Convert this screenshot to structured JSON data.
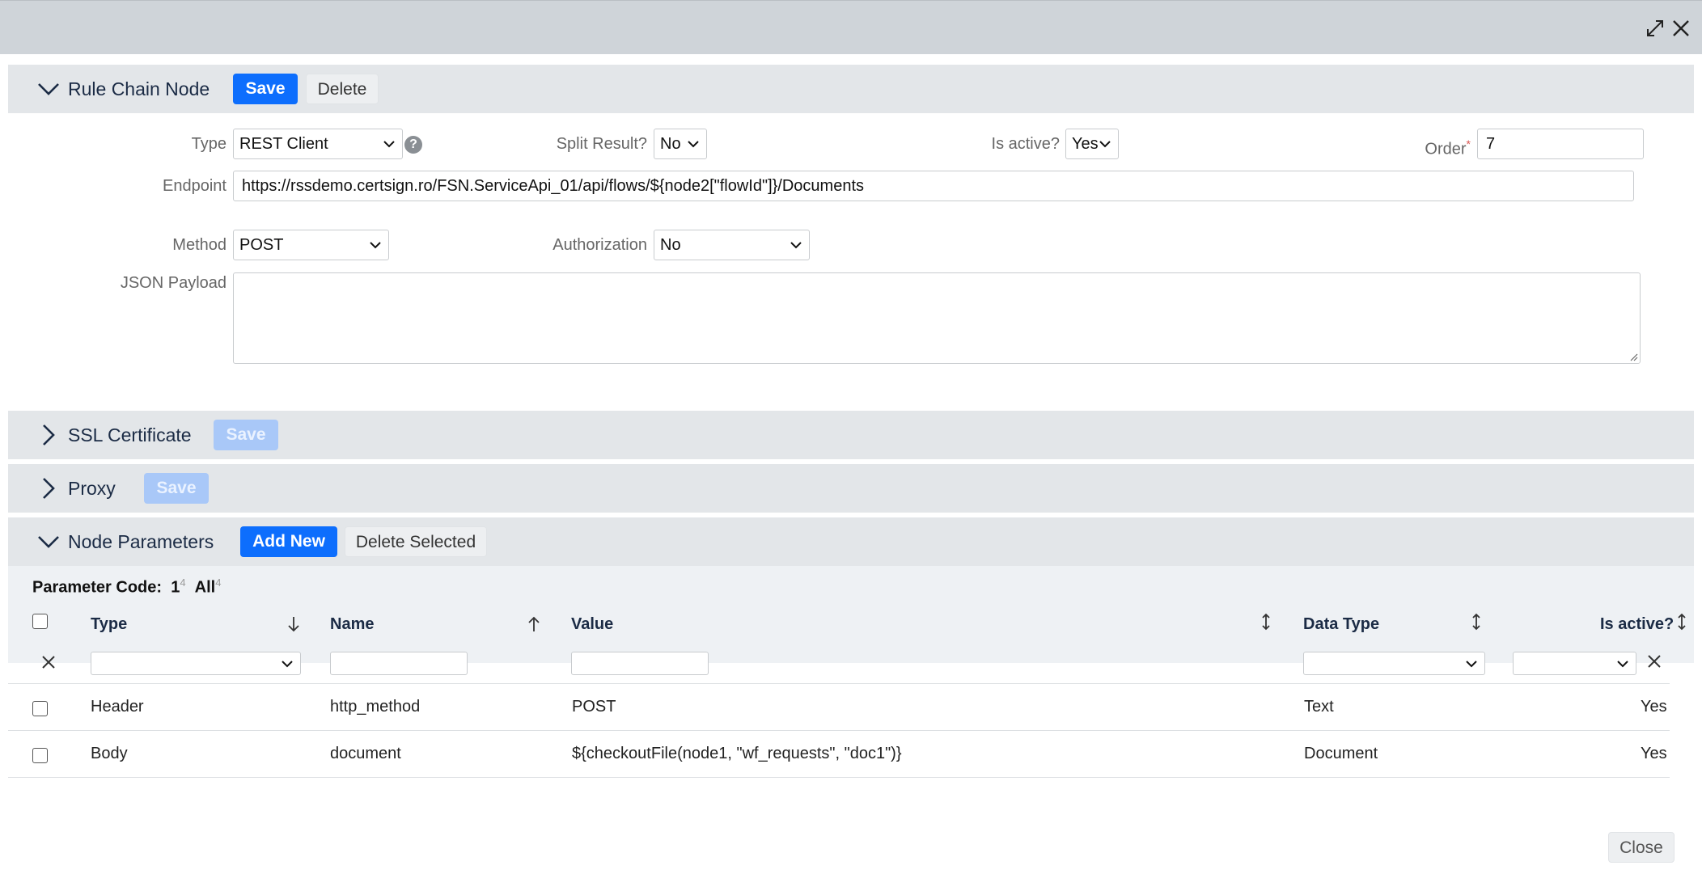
{
  "rule_chain_node": {
    "title": "Rule Chain Node",
    "save_label": "Save",
    "delete_label": "Delete",
    "type_label": "Type",
    "type_value": "REST Client",
    "split_result_label": "Split Result?",
    "split_result_value": "No",
    "is_active_label": "Is active?",
    "is_active_value": "Yes",
    "order_label": "Order",
    "order_required_mark": "*",
    "order_value": "7",
    "endpoint_label": "Endpoint",
    "endpoint_value": "https://rssdemo.certsign.ro/FSN.ServiceApi_01/api/flows/${node2[\"flowId\"]}/Documents",
    "method_label": "Method",
    "method_value": "POST",
    "authorization_label": "Authorization",
    "authorization_value": "No",
    "json_payload_label": "JSON Payload",
    "json_payload_value": ""
  },
  "ssl_certificate": {
    "title": "SSL Certificate",
    "save_label": "Save"
  },
  "proxy": {
    "title": "Proxy",
    "save_label": "Save"
  },
  "node_parameters": {
    "title": "Node Parameters",
    "add_new_label": "Add New",
    "delete_selected_label": "Delete Selected",
    "filter_label": "Parameter Code:",
    "filter_options": [
      {
        "label": "1",
        "count": "4"
      },
      {
        "label": "All",
        "count": "4"
      }
    ],
    "columns": {
      "type": "Type",
      "name": "Name",
      "value": "Value",
      "data_type": "Data Type",
      "is_active": "Is active?"
    },
    "rows": [
      {
        "type": "Header",
        "name": "http_method",
        "value": "POST",
        "data_type": "Text",
        "is_active": "Yes"
      },
      {
        "type": "Body",
        "name": "document",
        "value": "${checkoutFile(node1, \"wf_requests\", \"doc1\")}",
        "data_type": "Document",
        "is_active": "Yes"
      }
    ]
  },
  "footer": {
    "close_label": "Close"
  },
  "colors": {
    "primary": "#0d6efd",
    "primary_disabled": "#a9c8f8",
    "section_bg": "#e3e6e9",
    "topbar_bg": "#cfd4d9"
  }
}
